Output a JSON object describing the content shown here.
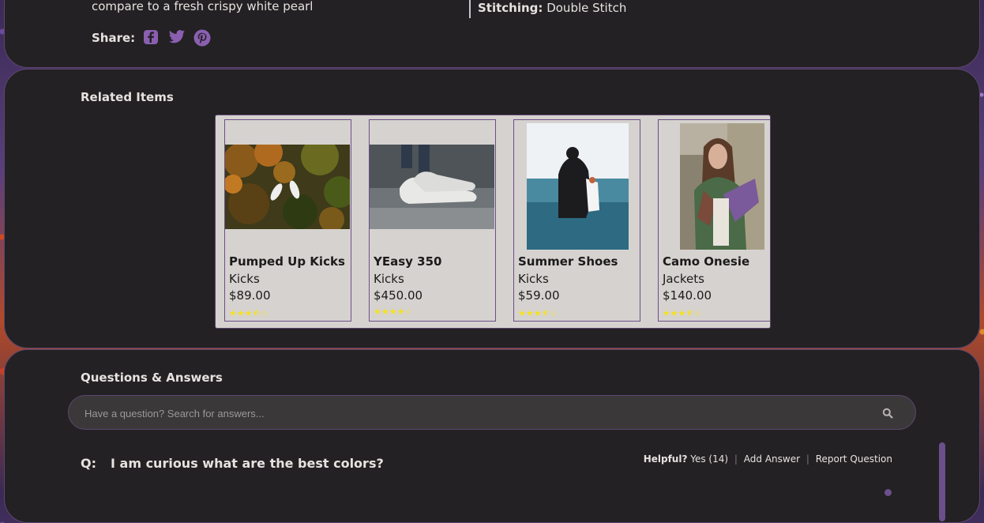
{
  "overview": {
    "description_fragment": "compare to a fresh crispy white pearl",
    "share_label": "Share:",
    "share_icons": [
      "facebook-icon",
      "twitter-icon",
      "pinterest-icon"
    ],
    "stitching_label": "Stitching:",
    "stitching_value": "Double Stitch"
  },
  "related": {
    "title": "Related Items",
    "items": [
      {
        "name": "Pumped Up Kicks",
        "category": "Kicks",
        "price": "$89.00",
        "rating": 3.5
      },
      {
        "name": "YEasy 350",
        "category": "Kicks",
        "price": "$450.00",
        "rating": 4
      },
      {
        "name": "Summer Shoes",
        "category": "Kicks",
        "price": "$59.00",
        "rating": 3.5
      },
      {
        "name": "Camo Onesie",
        "category": "Jackets",
        "price": "$140.00",
        "rating": 3.5
      }
    ]
  },
  "qa": {
    "title": "Questions & Answers",
    "search_placeholder": "Have a question? Search for answers...",
    "question": {
      "prefix": "Q:",
      "text": "I am curious what are the best colors?",
      "helpful_label": "Helpful?",
      "yes_label": "Yes (14)",
      "add_answer_label": "Add Answer",
      "report_label": "Report Question"
    }
  },
  "colors": {
    "accent": "#6b4f8a",
    "panel_bg": "#232123",
    "star": "#f4e21d"
  }
}
